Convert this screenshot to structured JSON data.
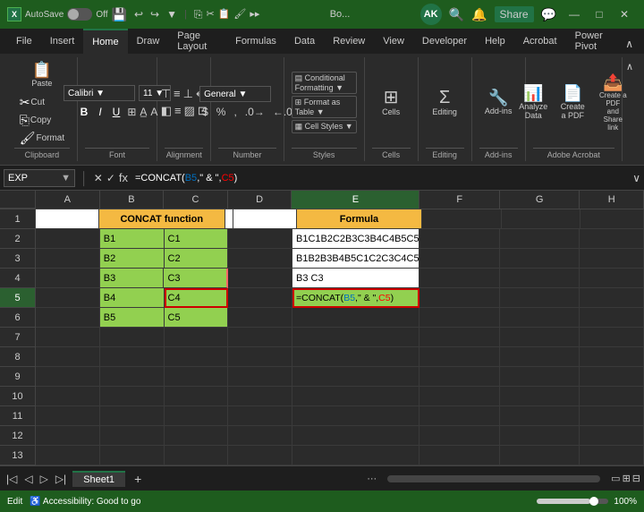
{
  "titlebar": {
    "app": "AutoSave",
    "toggle_state": "Off",
    "title": "Bo...",
    "user_initial": "AK",
    "window_controls": [
      "—",
      "□",
      "✕"
    ]
  },
  "ribbon": {
    "tabs": [
      "File",
      "Insert",
      "Home",
      "Draw",
      "Page Layout",
      "Formulas",
      "Data",
      "Review",
      "View",
      "Developer",
      "Help",
      "Acrobat",
      "Power Pivot"
    ],
    "active_tab": "Home",
    "groups": [
      {
        "label": "Clipboard",
        "icon": "📋"
      },
      {
        "label": "Font",
        "icon": "A"
      },
      {
        "label": "Alignment",
        "icon": "≡"
      },
      {
        "label": "Number",
        "icon": "%"
      },
      {
        "label": "Styles",
        "buttons": [
          "Conditional Formatting",
          "Format as Table",
          "Cell Styles"
        ]
      },
      {
        "label": "Cells",
        "icon": "⬜"
      },
      {
        "label": "Editing",
        "icon": "Σ"
      },
      {
        "label": "Add-ins",
        "icon": "🔧"
      },
      {
        "label": "Adobe Acrobat",
        "buttons": [
          "Analyze Data",
          "Create a PDF",
          "Create a PDF and Share link"
        ]
      }
    ]
  },
  "formula_bar": {
    "name_box": "EXP",
    "formula": "=CONCAT(B5,\" & \",C5)"
  },
  "columns": {
    "widths": [
      40,
      80,
      80,
      80,
      160,
      140,
      100,
      100,
      100
    ],
    "labels": [
      "",
      "A",
      "B",
      "C",
      "D",
      "E",
      "F",
      "G",
      "H"
    ]
  },
  "rows": {
    "count": 13,
    "labels": [
      "1",
      "2",
      "3",
      "4",
      "5",
      "6",
      "7",
      "8",
      "9",
      "10",
      "11",
      "12",
      "13"
    ]
  },
  "cells": {
    "header_row": {
      "B1": "CONCAT function",
      "E1": "Formula"
    },
    "data": [
      {
        "row": 2,
        "B": "B1",
        "C": "C1",
        "E": "B1C1B2C2B3C3B4C4B5C5"
      },
      {
        "row": 3,
        "B": "B2",
        "C": "C2",
        "E": "B1B2B3B4B5C1C2C3C4C5"
      },
      {
        "row": 4,
        "B": "B3",
        "C": "C3",
        "E": "B3 C3"
      },
      {
        "row": 5,
        "B": "B4",
        "C": "C4",
        "E": "=CONCAT(B5,\" & \",C5)"
      },
      {
        "row": 6,
        "B": "B5",
        "C": "C5",
        "E": ""
      }
    ]
  },
  "sheet_tabs": {
    "tabs": [
      "Sheet1"
    ],
    "active": "Sheet1"
  },
  "status_bar": {
    "mode": "Edit",
    "accessibility": "Accessibility: Good to go",
    "zoom": "100%"
  }
}
